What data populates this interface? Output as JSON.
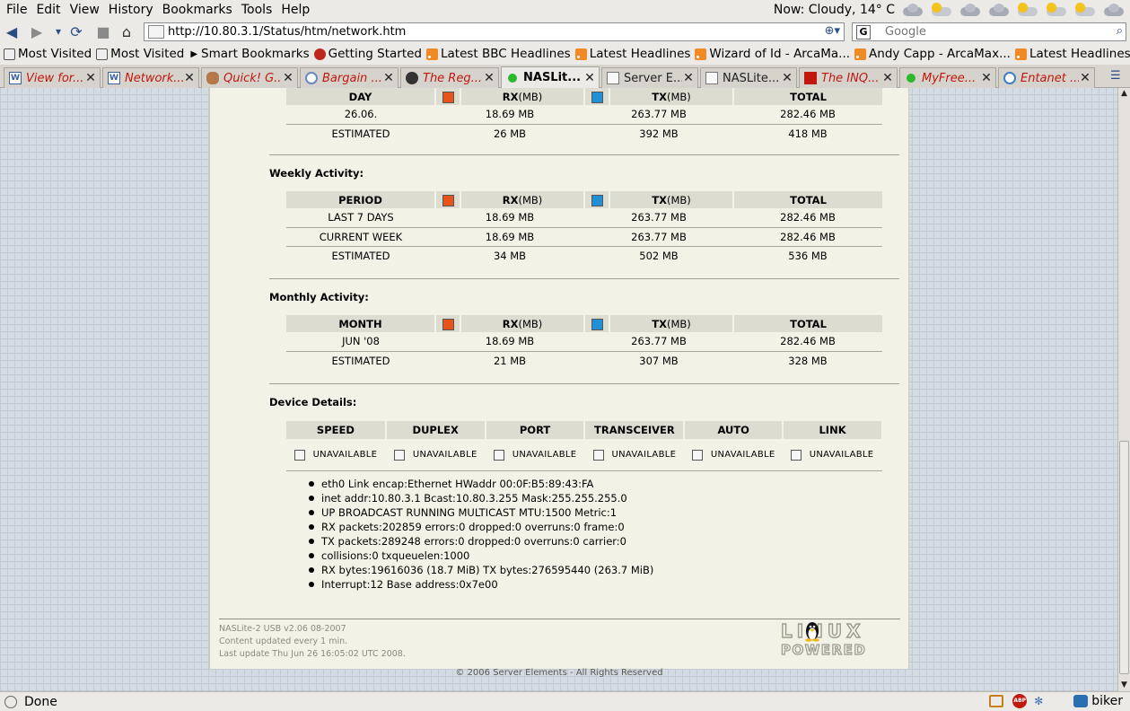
{
  "menubar": {
    "items": [
      "File",
      "Edit",
      "View",
      "History",
      "Bookmarks",
      "Tools",
      "Help"
    ],
    "weather": "Now: Cloudy, 14° C"
  },
  "navbar": {
    "url": "http://10.80.3.1/Status/htm/network.htm",
    "search_placeholder": "Google"
  },
  "bookmarks": [
    {
      "label": "Most Visited",
      "icon": "bookmark-icon"
    },
    {
      "label": "Most Visited",
      "icon": "bookmark-icon"
    },
    {
      "label": "Smart Bookmarks",
      "icon": "arrow-icon"
    },
    {
      "label": "Getting Started",
      "icon": "firefox-icon"
    },
    {
      "label": "Latest BBC Headlines",
      "icon": "rss-icon"
    },
    {
      "label": "Latest Headlines",
      "icon": "rss-icon"
    },
    {
      "label": "Wizard of Id - ArcaMa...",
      "icon": "rss-icon"
    },
    {
      "label": "Andy Capp - ArcaMax...",
      "icon": "rss-icon"
    },
    {
      "label": "Latest Headlines",
      "icon": "rss-icon"
    }
  ],
  "tabs": [
    {
      "label": "View for...",
      "icon": "w"
    },
    {
      "label": "Network...",
      "icon": "w"
    },
    {
      "label": "Quick! G...",
      "icon": "face"
    },
    {
      "label": "Bargain ...",
      "icon": "moon"
    },
    {
      "label": "The Reg...",
      "icon": "swirl"
    },
    {
      "label": "NASLit...",
      "icon": "g",
      "active": true
    },
    {
      "label": "Server E...",
      "icon": "doc",
      "plain": true
    },
    {
      "label": "NASLite...",
      "icon": "doc",
      "plain": true
    },
    {
      "label": "The INQ...",
      "icon": "inq"
    },
    {
      "label": "MyFree...",
      "icon": "g"
    },
    {
      "label": "Entanet ...",
      "icon": "ent"
    }
  ],
  "daily": {
    "headers": [
      "DAY",
      "RX",
      "(MB)",
      "TX",
      "(MB)",
      "TOTAL"
    ],
    "rows": [
      [
        "26.06.",
        "18.69 MB",
        "263.77 MB",
        "282.46 MB"
      ],
      [
        "ESTIMATED",
        "26 MB",
        "392 MB",
        "418 MB"
      ]
    ]
  },
  "weekly": {
    "title": "Weekly Activity:",
    "headers": [
      "PERIOD",
      "RX",
      "(MB)",
      "TX",
      "(MB)",
      "TOTAL"
    ],
    "rows": [
      [
        "LAST 7 DAYS",
        "18.69 MB",
        "263.77 MB",
        "282.46 MB"
      ],
      [
        "CURRENT WEEK",
        "18.69 MB",
        "263.77 MB",
        "282.46 MB"
      ],
      [
        "ESTIMATED",
        "34 MB",
        "502 MB",
        "536 MB"
      ]
    ]
  },
  "monthly": {
    "title": "Monthly Activity:",
    "headers": [
      "MONTH",
      "RX",
      "(MB)",
      "TX",
      "(MB)",
      "TOTAL"
    ],
    "rows": [
      [
        "JUN '08",
        "18.69 MB",
        "263.77 MB",
        "282.46 MB"
      ],
      [
        "ESTIMATED",
        "21 MB",
        "307 MB",
        "328 MB"
      ]
    ]
  },
  "device": {
    "title": "Device Details:",
    "headers": [
      "SPEED",
      "DUPLEX",
      "PORT",
      "TRANSCEIVER",
      "AUTO",
      "LINK"
    ],
    "values": [
      "UNAVAILABLE",
      "UNAVAILABLE",
      "UNAVAILABLE",
      "UNAVAILABLE",
      "UNAVAILABLE",
      "UNAVAILABLE"
    ],
    "interface": [
      "eth0 Link encap:Ethernet HWaddr 00:0F:B5:89:43:FA",
      "inet addr:10.80.3.1 Bcast:10.80.3.255 Mask:255.255.255.0",
      "UP BROADCAST RUNNING MULTICAST MTU:1500 Metric:1",
      "RX packets:202859 errors:0 dropped:0 overruns:0 frame:0",
      "TX packets:289248 errors:0 dropped:0 overruns:0 carrier:0",
      "collisions:0 txqueuelen:1000",
      "RX bytes:19616036 (18.7 MiB) TX bytes:276595440 (263.7 MiB)",
      "Interrupt:12 Base address:0x7e00"
    ]
  },
  "footer": {
    "version": "NASLite-2 USB v2.06 08-2007",
    "update_rate": "Content updated every 1 min.",
    "last_update": "Last update Thu Jun 26 16:05:02 UTC 2008.",
    "copyright": "© 2006 Server Elements - All Rights Reserved",
    "logo_top": "LINUX",
    "logo_bottom": "POWERED"
  },
  "statusbar": {
    "status": "Done",
    "user": "biker"
  },
  "colors": {
    "rx_swatch": "#e8531c",
    "tx_swatch": "#1f8fd6",
    "page_bg": "#f3f2e6",
    "active_tab_label": "#000000",
    "inactive_tab_label": "#c1170c"
  }
}
